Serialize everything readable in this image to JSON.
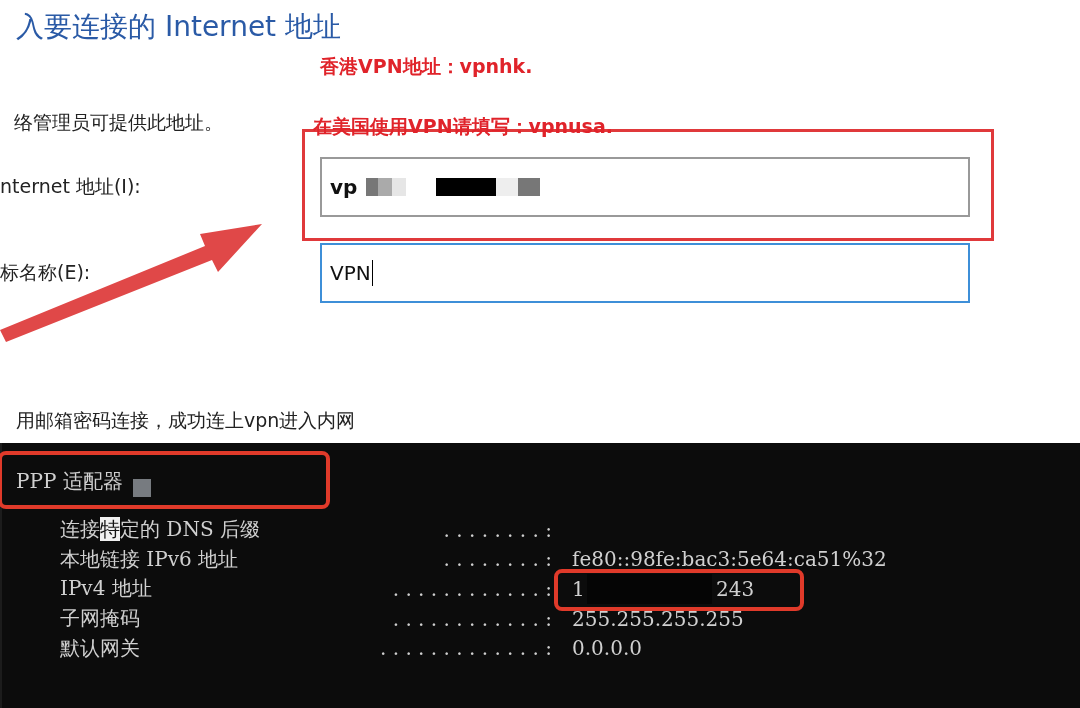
{
  "dialog": {
    "title": "入要连接的 Internet 地址",
    "hint": "络管理员可提供此地址。",
    "fields": [
      {
        "label": "nternet 地址(I):",
        "value": "vp",
        "redacted": true,
        "focused": false,
        "annotated": true
      },
      {
        "label": "标名称(E):",
        "value": "VPN",
        "redacted": false,
        "focused": true,
        "annotated": false
      }
    ]
  },
  "annotations": [
    "香港VPN地址：vpnhk.",
    "在美国使用VPN请填写：vpnusa."
  ],
  "caption": "用邮箱密码连接，成功连上vpn进入内网",
  "terminal": {
    "adapter": "PPP 适配器",
    "rows": [
      {
        "segments": [
          {
            "text": "连接",
            "selected": false
          },
          {
            "text": "特",
            "selected": true
          },
          {
            "text": "定的 DNS 后缀",
            "selected": false
          }
        ],
        "dots": ". . . . . . . . :",
        "value": "",
        "value_end": "",
        "annotated": false
      },
      {
        "segments": [
          {
            "text": "本地链接 IPv6 地址",
            "selected": false
          }
        ],
        "dots": ". . . . . . . . :",
        "value": "fe80::98fe:bac3:5e64:ca51%32",
        "value_end": "",
        "annotated": false
      },
      {
        "segments": [
          {
            "text": "IPv4 地址",
            "selected": false
          }
        ],
        "dots": ". . . . . . . . . . . . :",
        "value": "1",
        "value_end": "243",
        "annotated": true
      },
      {
        "segments": [
          {
            "text": "子网掩码",
            "selected": false
          }
        ],
        "dots": "  . . . . . . . . . . . . :",
        "value": "255.255.255.255",
        "value_end": "",
        "annotated": false
      },
      {
        "segments": [
          {
            "text": "默认网关",
            "selected": false
          }
        ],
        "dots": ". . . . . . . . . . . . . :",
        "value": "0.0.0.0",
        "value_end": "",
        "annotated": false
      }
    ]
  }
}
